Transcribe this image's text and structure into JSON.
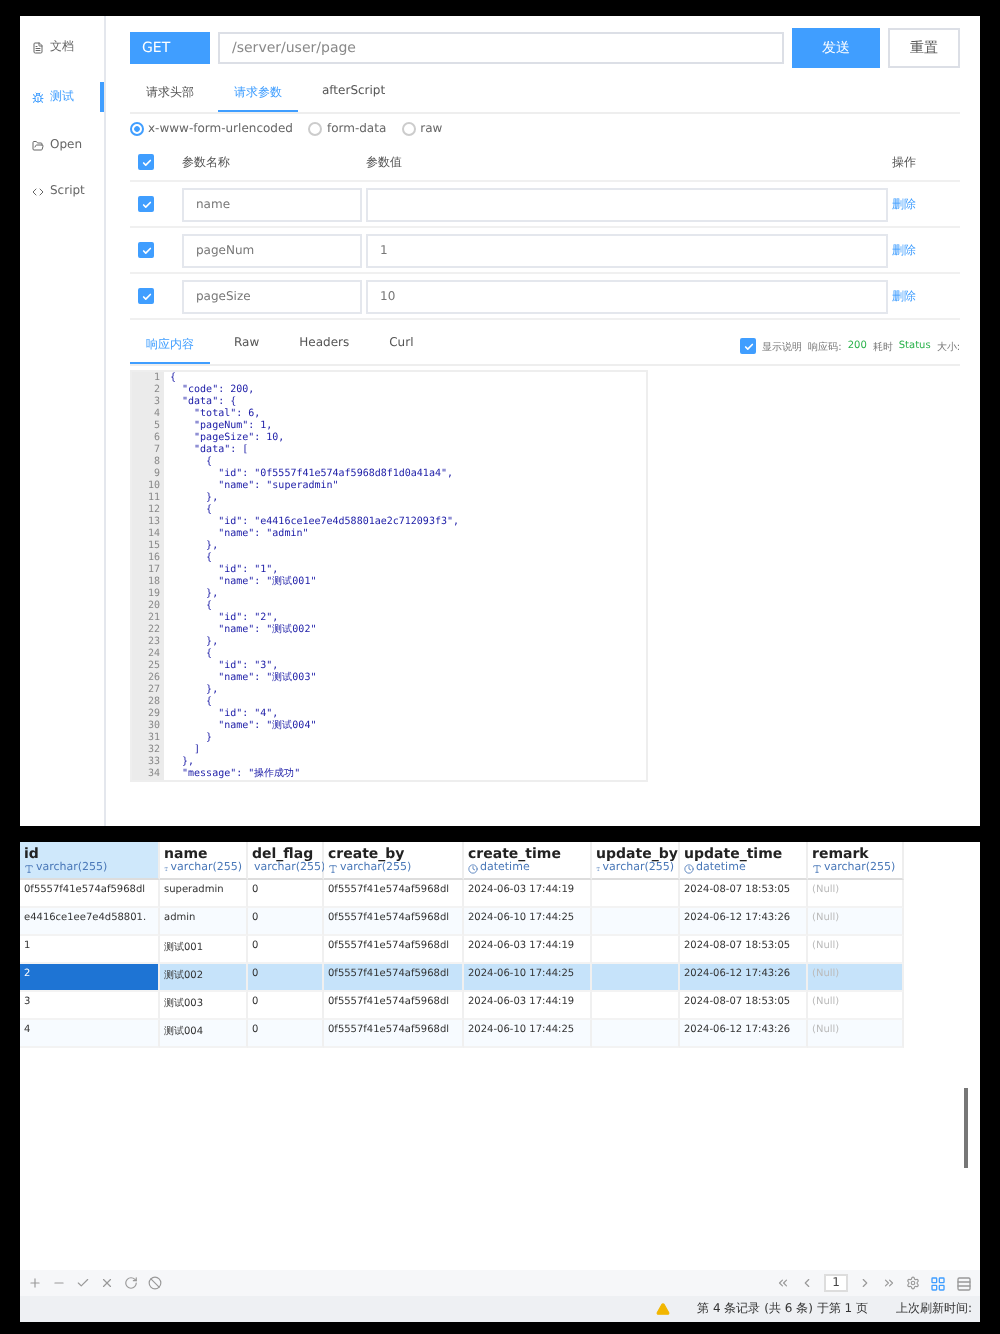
{
  "api_tool": {
    "sidebar": [
      {
        "label": "文档",
        "kind": "doc",
        "selected": false
      },
      {
        "label": "测试",
        "kind": "test",
        "selected": true
      },
      {
        "label": "Open",
        "kind": "open",
        "selected": false
      },
      {
        "label": "Script",
        "kind": "script",
        "selected": false
      }
    ],
    "method": "GET",
    "url": "/server/user/page",
    "send_button": "发送",
    "reset_button": "重置",
    "request_tabs": [
      {
        "label": "请求头部",
        "selected": false
      },
      {
        "label": "请求参数",
        "selected": true
      },
      {
        "label": "afterScript",
        "selected": false
      }
    ],
    "body_types": [
      {
        "label": "x-www-form-urlencoded",
        "selected": true
      },
      {
        "label": "form-data",
        "selected": false
      },
      {
        "label": "raw",
        "selected": false
      }
    ],
    "params": {
      "columns": [
        "参数名称",
        "参数值",
        "操作"
      ],
      "all_checked": true,
      "rows": [
        {
          "checked": true,
          "name": "name",
          "value": "",
          "action": "删除"
        },
        {
          "checked": true,
          "name": "pageNum",
          "value": "1",
          "action": "删除"
        },
        {
          "checked": true,
          "name": "pageSize",
          "value": "10",
          "action": "删除"
        }
      ]
    },
    "response_tabs": [
      {
        "label": "响应内容",
        "selected": true
      },
      {
        "label": "Raw",
        "selected": false
      },
      {
        "label": "Headers",
        "selected": false
      },
      {
        "label": "Curl",
        "selected": false
      }
    ],
    "show_description": {
      "label": "显示说明",
      "checked": true
    },
    "response_meta": [
      {
        "label": "响应码:",
        "value": "200"
      },
      {
        "label": "耗时",
        "value": "Status"
      },
      {
        "label": "大小:"
      }
    ],
    "code_lines": [
      {
        "n": "1",
        "text": "{"
      },
      {
        "n": "2",
        "text": "  \"code\": 200,"
      },
      {
        "n": "3",
        "text": "  \"data\": {"
      },
      {
        "n": "4",
        "text": "    \"total\": 6,"
      },
      {
        "n": "5",
        "text": "    \"pageNum\": 1,"
      },
      {
        "n": "6",
        "text": "    \"pageSize\": 10,"
      },
      {
        "n": "7",
        "text": "    \"data\": ["
      },
      {
        "n": "8",
        "text": "      {"
      },
      {
        "n": "9",
        "text": "        \"id\": \"0f5557f41e574af5968d8f1d0a41a4\","
      },
      {
        "n": "10",
        "text": "        \"name\": \"superadmin\""
      },
      {
        "n": "11",
        "text": "      },"
      },
      {
        "n": "12",
        "text": "      {"
      },
      {
        "n": "13",
        "text": "        \"id\": \"e4416ce1ee7e4d58801ae2c712093f3\","
      },
      {
        "n": "14",
        "text": "        \"name\": \"admin\""
      },
      {
        "n": "15",
        "text": "      },"
      },
      {
        "n": "16",
        "text": "      {"
      },
      {
        "n": "17",
        "text": "        \"id\": \"1\","
      },
      {
        "n": "18",
        "text": "        \"name\": \"测试001\""
      },
      {
        "n": "19",
        "text": "      },"
      },
      {
        "n": "20",
        "text": "      {"
      },
      {
        "n": "21",
        "text": "        \"id\": \"2\","
      },
      {
        "n": "22",
        "text": "        \"name\": \"测试002\""
      },
      {
        "n": "23",
        "text": "      },"
      },
      {
        "n": "24",
        "text": "      {"
      },
      {
        "n": "25",
        "text": "        \"id\": \"3\","
      },
      {
        "n": "26",
        "text": "        \"name\": \"测试003\""
      },
      {
        "n": "27",
        "text": "      },"
      },
      {
        "n": "28",
        "text": "      {"
      },
      {
        "n": "29",
        "text": "        \"id\": \"4\","
      },
      {
        "n": "30",
        "text": "        \"name\": \"测试004\""
      },
      {
        "n": "31",
        "text": "      }"
      },
      {
        "n": "32",
        "text": "    ]"
      },
      {
        "n": "33",
        "text": "  },"
      },
      {
        "n": "34",
        "text": "  \"message\": \"操作成功\""
      }
    ]
  },
  "db_table": {
    "columns": [
      {
        "name": "id",
        "type": "varchar(255)",
        "kind": "text",
        "selected": true,
        "muted": false
      },
      {
        "name": "name",
        "type": "varchar(255)",
        "kind": "text",
        "selected": false,
        "muted": false
      },
      {
        "name": "del_flag",
        "type": "varchar(255)",
        "kind": "text",
        "selected": false,
        "muted": false
      },
      {
        "name": "create_by",
        "type": "varchar(255)",
        "kind": "text",
        "selected": false,
        "muted": false
      },
      {
        "name": "create_time",
        "type": "datetime",
        "kind": "time",
        "selected": false,
        "muted": false
      },
      {
        "name": "update_by",
        "type": "varchar(255)",
        "kind": "text",
        "selected": false,
        "muted": false
      },
      {
        "name": "update_time",
        "type": "datetime",
        "kind": "time",
        "selected": false,
        "muted": false
      },
      {
        "name": "remark",
        "type": "varchar(255)",
        "kind": "text",
        "selected": false,
        "muted": true
      }
    ],
    "rows": [
      {
        "selected": false,
        "cells": [
          "0f5557f41e574af5968dl",
          "superadmin",
          "0",
          "0f5557f41e574af5968dl",
          "2024-06-03 17:44:19",
          "",
          "2024-08-07 18:53:05",
          "(Null)"
        ]
      },
      {
        "selected": false,
        "cells": [
          "e4416ce1ee7e4d58801.",
          "admin",
          "0",
          "0f5557f41e574af5968dl",
          "2024-06-10 17:44:25",
          "",
          "2024-06-12 17:43:26",
          "(Null)"
        ]
      },
      {
        "selected": false,
        "cells": [
          "1",
          "测试001",
          "0",
          "0f5557f41e574af5968dl",
          "2024-06-03 17:44:19",
          "",
          "2024-08-07 18:53:05",
          "(Null)"
        ]
      },
      {
        "selected": true,
        "cells": [
          "2",
          "测试002",
          "0",
          "0f5557f41e574af5968dl",
          "2024-06-10 17:44:25",
          "",
          "2024-06-12 17:43:26",
          "(Null)"
        ]
      },
      {
        "selected": false,
        "cells": [
          "3",
          "测试003",
          "0",
          "0f5557f41e574af5968dl",
          "2024-06-03 17:44:19",
          "",
          "2024-08-07 18:53:05",
          "(Null)"
        ]
      },
      {
        "selected": false,
        "cells": [
          "4",
          "测试004",
          "0",
          "0f5557f41e574af5968dl",
          "2024-06-10 17:44:25",
          "",
          "2024-06-12 17:43:26",
          "(Null)"
        ]
      }
    ],
    "page": "1",
    "record_status": "第 4 条记录 (共 6 条) 于第 1 页",
    "refresh_status": "上次刷新时间:"
  }
}
